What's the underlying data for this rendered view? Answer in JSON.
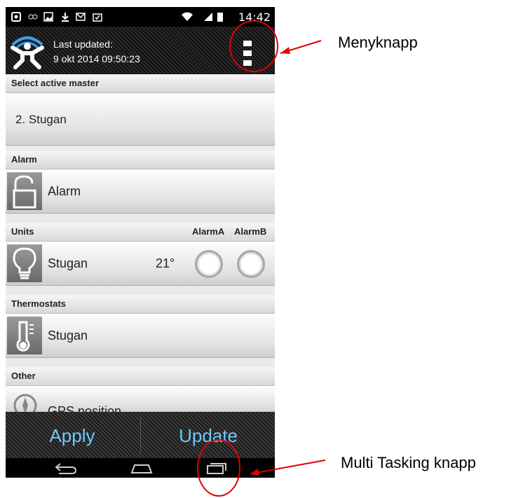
{
  "status_bar": {
    "time": "14:42"
  },
  "header": {
    "title": "Last updated:",
    "date": "9 okt 2014 09:50:23"
  },
  "sections": {
    "master": "Select active master",
    "alarm": "Alarm",
    "units": "Units",
    "alarmA": "AlarmA",
    "alarmB": "AlarmB",
    "thermostats": "Thermostats",
    "other": "Other"
  },
  "rows": {
    "master": "2. Stugan",
    "alarm": "Alarm",
    "unit_name": "Stugan",
    "unit_temp": "21°",
    "thermostat": "Stugan",
    "gps": "GPS position"
  },
  "buttons": {
    "apply": "Apply",
    "update": "Update"
  },
  "annotations": {
    "menu": "Menyknapp",
    "multitask": "Multi Tasking knapp"
  },
  "colors": {
    "button_text": "#6ec8ff",
    "annotation": "#e00000"
  }
}
